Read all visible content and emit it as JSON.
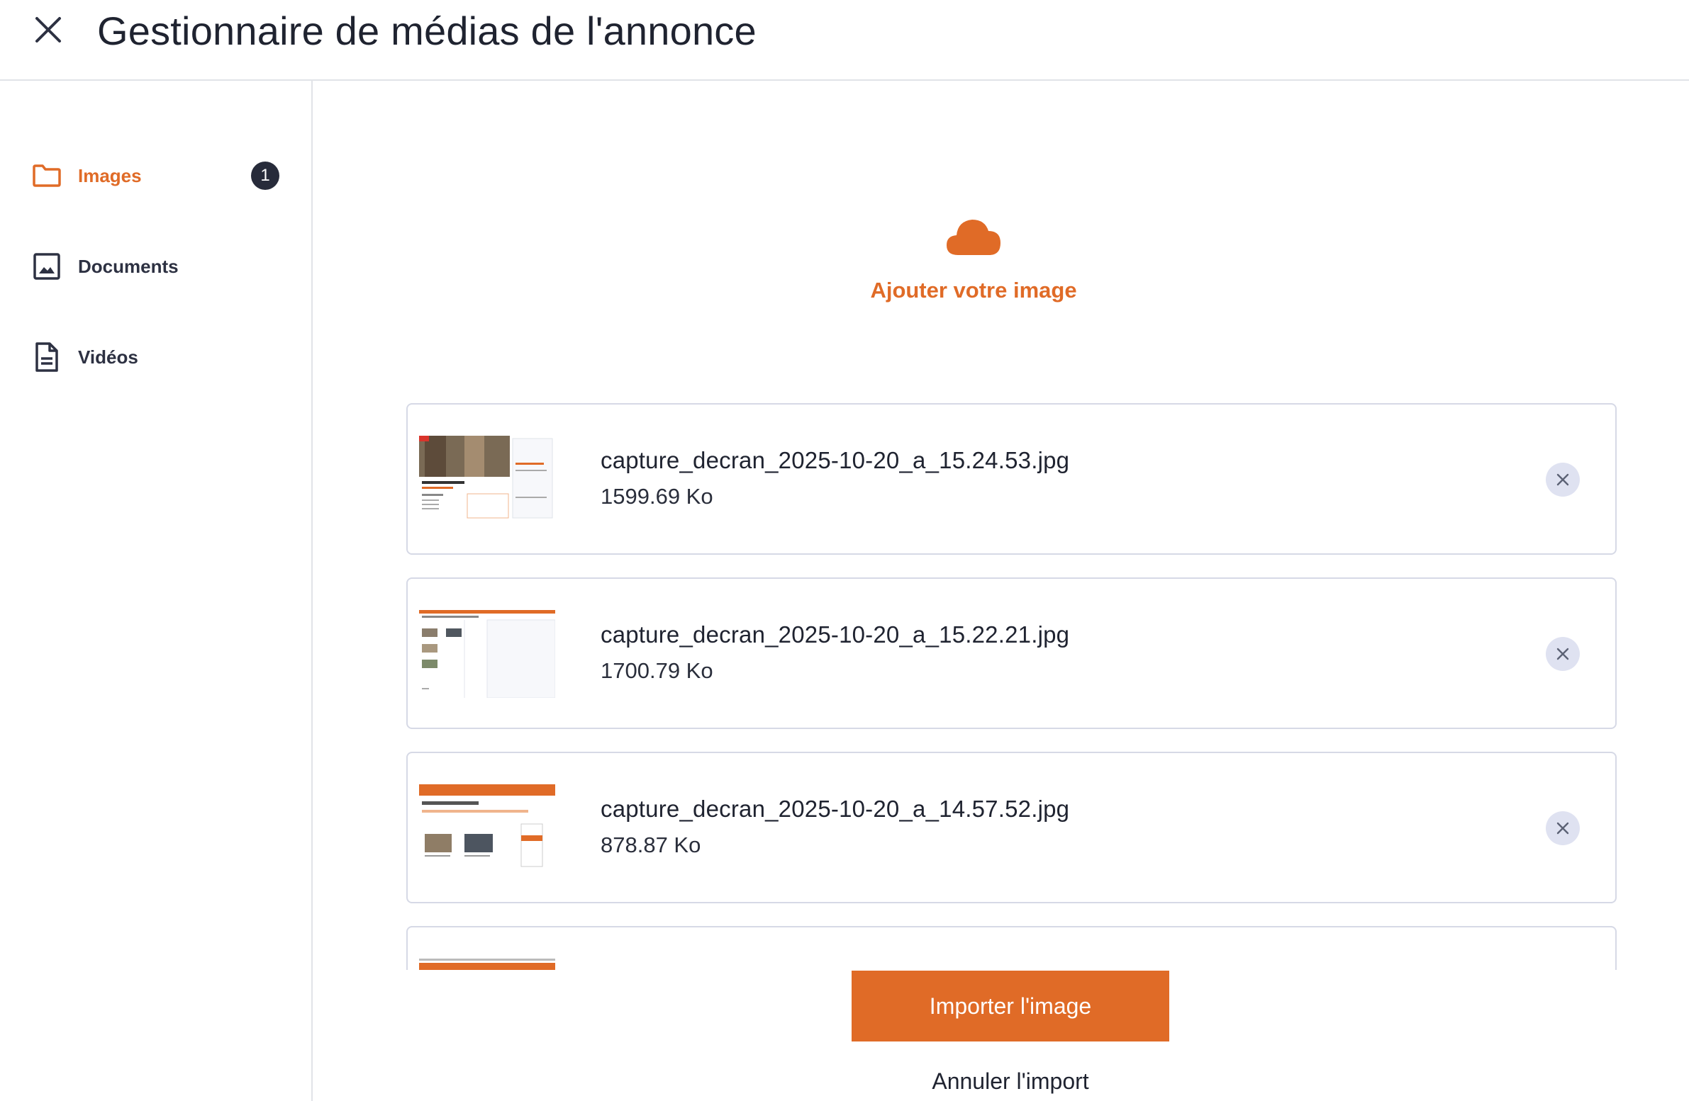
{
  "header": {
    "title": "Gestionnaire de médias de l'annonce",
    "close_icon": "close-icon"
  },
  "sidebar": {
    "items": [
      {
        "label": "Images",
        "icon": "folder-icon",
        "active": true,
        "badge": "1"
      },
      {
        "label": "Documents",
        "icon": "image-icon",
        "active": false
      },
      {
        "label": "Vidéos",
        "icon": "document-icon",
        "active": false
      }
    ]
  },
  "upload": {
    "label": "Ajouter votre image",
    "icon": "cloud-icon"
  },
  "files": [
    {
      "name": "capture_decran_2025-10-20_a_15.24.53.jpg",
      "size": "1599.69 Ko"
    },
    {
      "name": "capture_decran_2025-10-20_a_15.22.21.jpg",
      "size": "1700.79 Ko"
    },
    {
      "name": "capture_decran_2025-10-20_a_14.57.52.jpg",
      "size": "878.87 Ko"
    }
  ],
  "actions": {
    "import_label": "Importer l'image",
    "cancel_label": "Annuler l'import"
  },
  "colors": {
    "accent": "#e06b27",
    "badge_bg": "#272b3a",
    "border": "#d6d9e6",
    "remove_bg": "#dfe2f1"
  }
}
